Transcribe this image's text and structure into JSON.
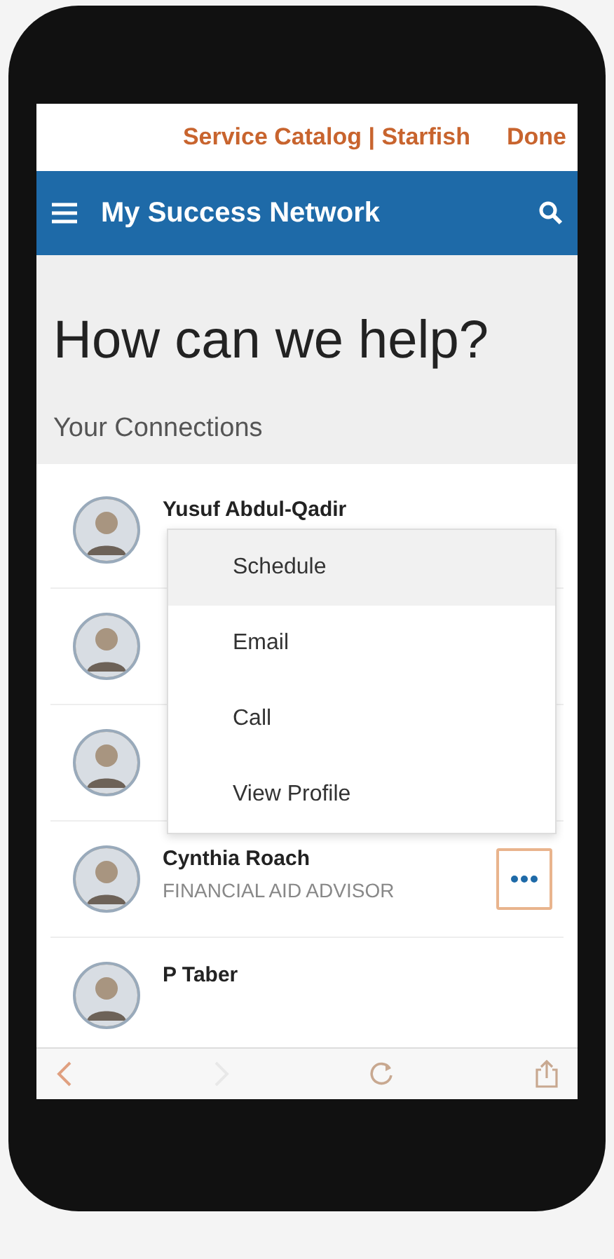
{
  "browser_bar": {
    "title": "Service Catalog | Starfish",
    "done": "Done"
  },
  "header": {
    "title": "My Success Network"
  },
  "heading": "How can we help?",
  "section_title": "Your Connections",
  "contacts": [
    {
      "name": "Yusuf Abdul-Qadir",
      "menu_open": false
    },
    {
      "menu_open": false
    },
    {
      "menu_open": false
    },
    {
      "name": "Cynthia Roach",
      "title": "FINANCIAL AID ADVISOR",
      "menu_open": true
    },
    {
      "name": "P Taber",
      "menu_open": false
    }
  ],
  "menu": [
    {
      "label": "Schedule",
      "selected": true
    },
    {
      "label": "Email",
      "selected": false
    },
    {
      "label": "Call",
      "selected": false
    },
    {
      "label": "View Profile",
      "selected": false
    }
  ]
}
